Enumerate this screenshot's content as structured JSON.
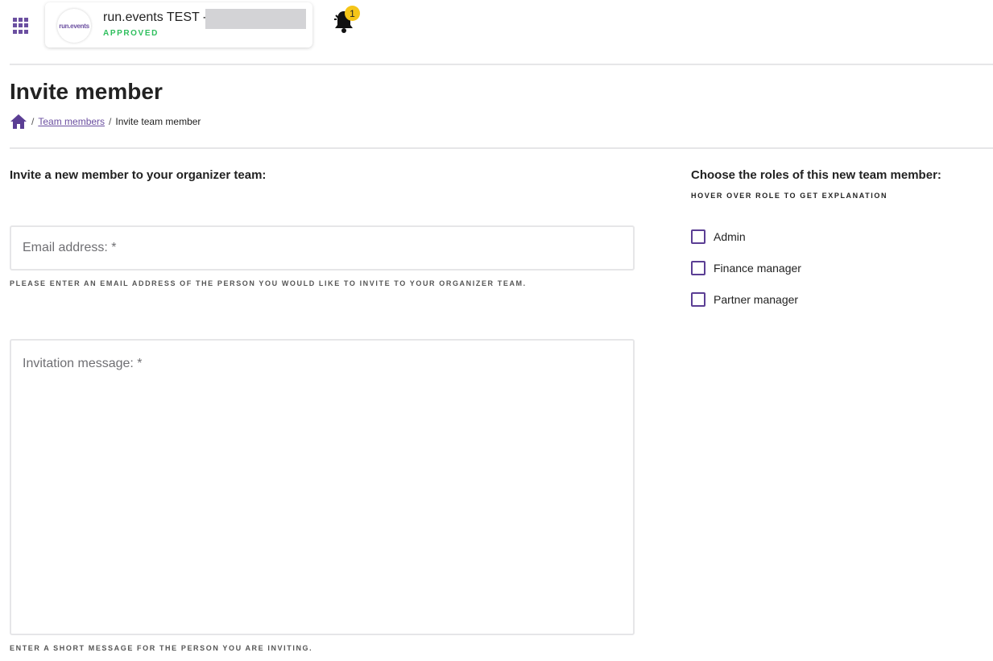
{
  "topbar": {
    "org": {
      "logo_text": "run.events",
      "name": "run.events TEST -",
      "status": "APPROVED"
    },
    "notifications": {
      "count": "1"
    }
  },
  "page": {
    "title": "Invite member",
    "breadcrumb": {
      "home_icon": "home-icon",
      "link": "Team members",
      "current": "Invite team member"
    }
  },
  "form": {
    "heading": "Invite a new member to your organizer team:",
    "email": {
      "placeholder": "Email address: *",
      "help": "PLEASE ENTER AN EMAIL ADDRESS OF THE PERSON YOU WOULD LIKE TO INVITE TO YOUR ORGANIZER TEAM."
    },
    "message": {
      "placeholder": "Invitation message: *",
      "help": "ENTER A SHORT MESSAGE FOR THE PERSON YOU ARE INVITING."
    }
  },
  "roles": {
    "heading": "Choose the roles of this new team member:",
    "hint": "HOVER OVER ROLE TO GET EXPLANATION",
    "items": [
      {
        "label": "Admin",
        "checked": false
      },
      {
        "label": "Finance manager",
        "checked": false
      },
      {
        "label": "Partner manager",
        "checked": false
      }
    ]
  },
  "colors": {
    "accent": "#6b4fa0",
    "approved": "#2fbf5e",
    "badge": "#f5c518",
    "divider": "#e6e6e8"
  }
}
